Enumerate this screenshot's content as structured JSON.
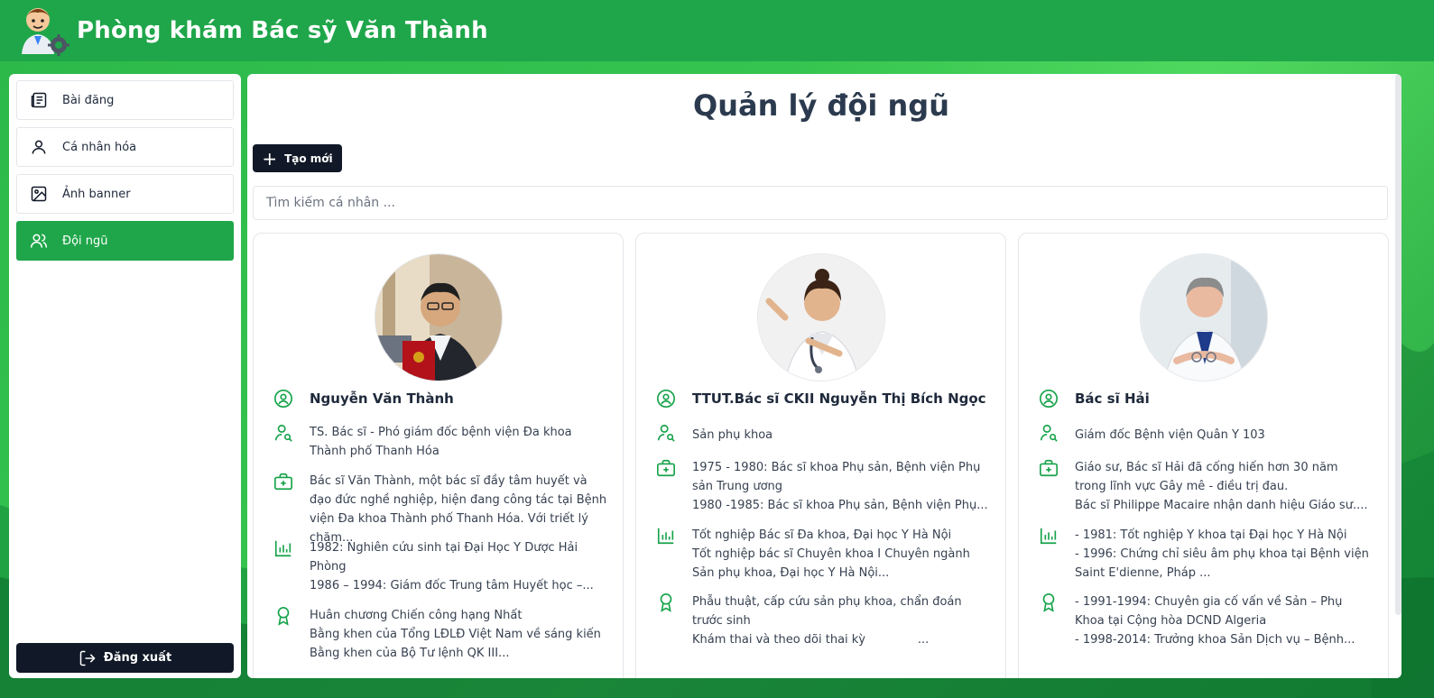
{
  "header": {
    "title": "Phòng khám Bác sỹ Văn Thành"
  },
  "sidebar": {
    "items": [
      {
        "label": "Bài đăng",
        "icon": "newspaper-icon"
      },
      {
        "label": "Cá nhân hóa",
        "icon": "user-icon"
      },
      {
        "label": "Ảnh banner",
        "icon": "image-icon"
      },
      {
        "label": "Đội ngũ",
        "icon": "users-icon",
        "active": true
      }
    ],
    "logout_label": "Đăng xuất"
  },
  "main": {
    "title": "Quản lý đội ngũ",
    "create_label": "Tạo mới",
    "search_placeholder": "Tìm kiếm cá nhân ...",
    "members": [
      {
        "name": "Nguyễn Văn Thành",
        "position": "TS. Bác sĩ - Phó giám đốc bệnh viện Đa khoa Thành phố Thanh Hóa",
        "bio": "Bác sĩ Văn Thành, một bác sĩ đầy tâm huyết và đạo đức nghề nghiệp, hiện đang công tác tại Bệnh viện Đa khoa Thành phố Thanh Hóa. Với triết lý chăm...",
        "education": "1982: Nghiên cứu sinh tại Đại Học Y Dược Hải Phòng\n1986 – 1994: Giám đốc Trung tâm Huyết học –...",
        "awards": "Huân chương Chiến công hạng Nhất\nBằng khen của Tổng LĐLĐ Việt Nam về sáng kiến\nBằng khen của Bộ Tư lệnh QK III..."
      },
      {
        "name": "TTUT.Bác sĩ CKII Nguyễn Thị Bích Ngọc",
        "position": "Sản phụ khoa",
        "bio": "1975 - 1980: Bác sĩ khoa Phụ sản, Bệnh viện Phụ sản Trung ương\n1980 -1985: Bác sĩ khoa Phụ sản, Bệnh viện Phụ...",
        "education": "Tốt nghiệp Bác sĩ Đa khoa, Đại học Y Hà Nội\nTốt nghiệp bác sĩ Chuyên khoa I Chuyên ngành Sản phụ khoa, Đại học Y Hà Nội...",
        "awards": "Phẫu thuật, cấp cứu sản phụ khoa, chẩn đoán trước sinh\nKhám thai và theo dõi thai kỳ              ..."
      },
      {
        "name": "Bác sĩ Hải",
        "position": "Giám đốc Bệnh viện Quân Y 103",
        "bio": "Giáo sư, Bác sĩ Hải đã cống hiến hơn 30 năm trong lĩnh vực Gây mê - điều trị đau.\nBác sĩ Philippe Macaire nhận danh hiệu Giáo sư....",
        "education": "- 1981: Tốt nghiệp Y khoa tại Đại học Y Hà Nội\n- 1996: Chứng chỉ siêu âm phụ khoa tại Bệnh viện Saint E'dienne, Pháp ...",
        "awards": "- 1991-1994: Chuyên gia cố vấn về Sản – Phụ Khoa tại Cộng hòa DCND Algeria\n- 1998-2014: Trưởng khoa Sản Dịch vụ – Bệnh..."
      }
    ]
  },
  "colors": {
    "brand": "#1fa64a",
    "dark": "#111827",
    "icon_green": "#16a34a"
  }
}
